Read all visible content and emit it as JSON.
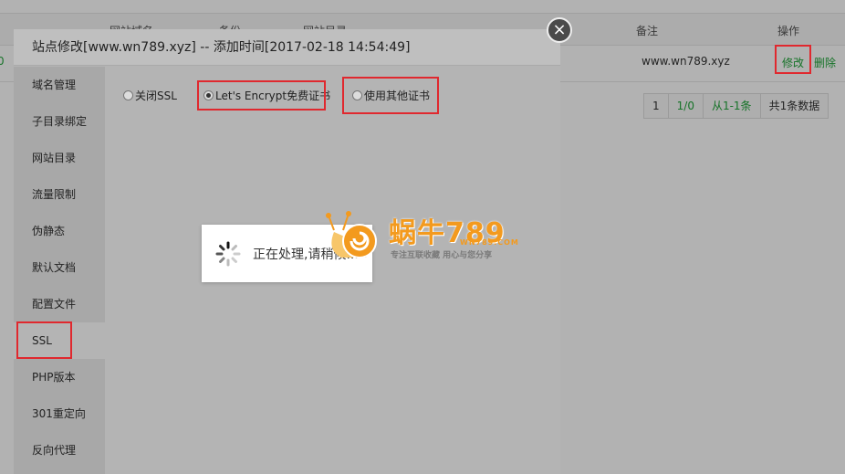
{
  "background": {
    "columns": [
      "网站域名",
      "备份",
      "网站目录",
      "备注",
      "操作"
    ],
    "row": {
      "status": "0",
      "remark": "www.wn789.xyz",
      "edit_label": "修改",
      "delete_label": "删除"
    },
    "pager": [
      "1",
      "1/0",
      "从1-1条",
      "共1条数据"
    ]
  },
  "modal": {
    "title": "站点修改[www.wn789.xyz] -- 添加时间[2017-02-18 14:54:49]",
    "close_label": "×",
    "sidebar": [
      {
        "label": "域名管理"
      },
      {
        "label": "子目录绑定"
      },
      {
        "label": "网站目录"
      },
      {
        "label": "流量限制"
      },
      {
        "label": "伪静态"
      },
      {
        "label": "默认文档"
      },
      {
        "label": "配置文件"
      },
      {
        "label": "SSL",
        "active": true
      },
      {
        "label": "PHP版本"
      },
      {
        "label": "301重定向"
      },
      {
        "label": "反向代理"
      }
    ],
    "ssl_options": [
      {
        "label": "关闭SSL",
        "checked": false
      },
      {
        "label": "Let's Encrypt免费证书",
        "checked": true
      },
      {
        "label": "使用其他证书",
        "checked": false
      }
    ],
    "loading_text": "正在处理,请稍候..."
  },
  "watermark": {
    "name": "蜗牛789",
    "domain": "WN789.COM",
    "slogan": "专注互联收藏    用心与您分享"
  },
  "colors": {
    "accent_green": "#20a53a",
    "highlight_red": "#e0282e",
    "logo_orange": "#f39a1e"
  }
}
